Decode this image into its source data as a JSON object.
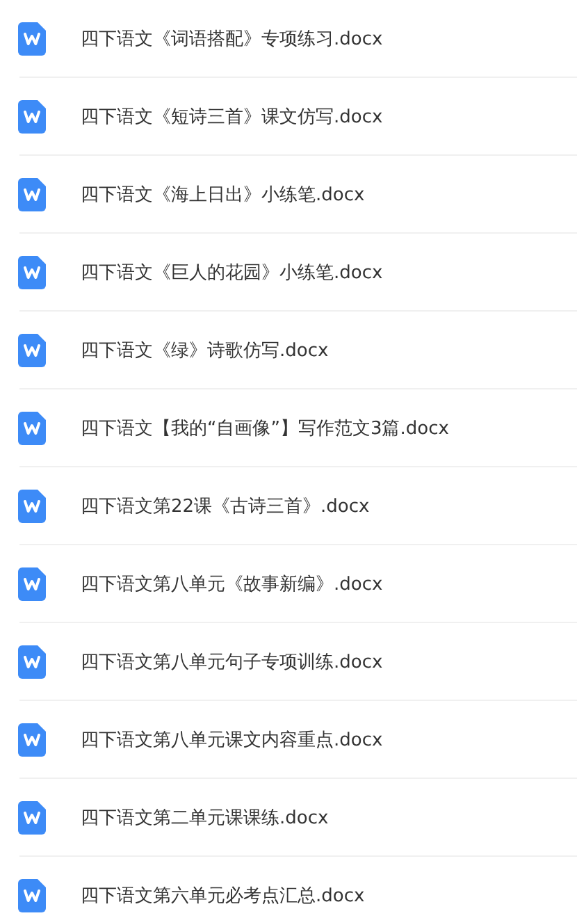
{
  "files": [
    {
      "name": "四下语文《词语搭配》专项练习.docx"
    },
    {
      "name": "四下语文《短诗三首》课文仿写.docx"
    },
    {
      "name": "四下语文《海上日出》小练笔.docx"
    },
    {
      "name": "四下语文《巨人的花园》小练笔.docx"
    },
    {
      "name": "四下语文《绿》诗歌仿写.docx"
    },
    {
      "name": "四下语文【我的“自画像”】写作范文3篇.docx"
    },
    {
      "name": "四下语文第22课《古诗三首》.docx"
    },
    {
      "name": "四下语文第八单元《故事新编》.docx"
    },
    {
      "name": "四下语文第八单元句子专项训练.docx"
    },
    {
      "name": "四下语文第八单元课文内容重点.docx"
    },
    {
      "name": "四下语文第二单元课课练.docx"
    },
    {
      "name": "四下语文第六单元必考点汇总.docx"
    }
  ]
}
